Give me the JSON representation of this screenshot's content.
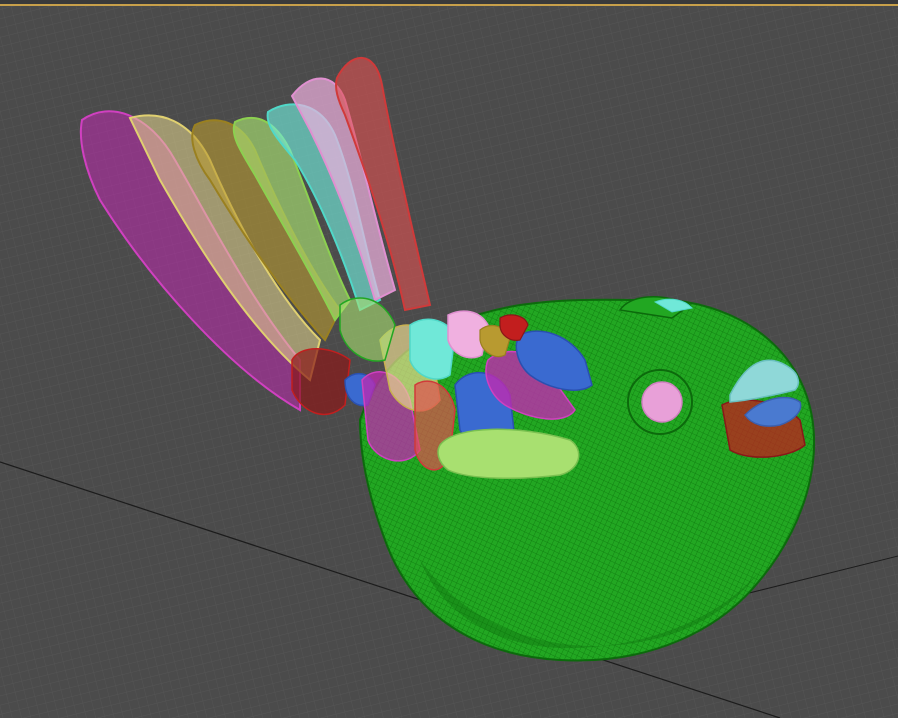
{
  "viewport": {
    "shading_mode": "wireframe",
    "background_color": "#4b4b4b",
    "grid_color": "#5a5a5a",
    "grid_axis_color": "#1c1c1c",
    "active_border_color": "#c8a04a"
  },
  "model": {
    "subject": "bird",
    "wire_colors": {
      "body": "#22a722",
      "body_dark": "#0c6a0c",
      "eye": "#e8a0d8",
      "beak_upper": "#8fd8d8",
      "beak_lower": "#4a7ad0",
      "cheek": "#c21e1e",
      "tail": [
        "#c02ab0",
        "#e8d890",
        "#b89a30",
        "#a8e070",
        "#70e8d8",
        "#f0b0e0",
        "#e05050"
      ],
      "wing": [
        "#3a6ad0",
        "#c02ab0",
        "#a8e070",
        "#e8d890",
        "#c21e1e",
        "#70e8d8",
        "#e05050",
        "#f0b0e0"
      ]
    }
  }
}
